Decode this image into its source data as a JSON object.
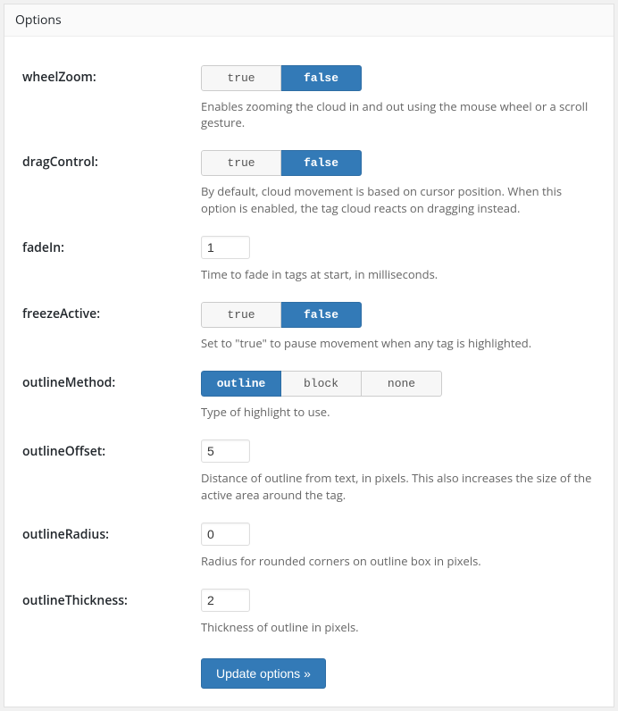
{
  "panel": {
    "title": "Options"
  },
  "options": {
    "wheelZoom": {
      "label": "wheelZoom:",
      "choices": [
        "true",
        "false"
      ],
      "selected": "false",
      "description": "Enables zooming the cloud in and out using the mouse wheel or a scroll gesture."
    },
    "dragControl": {
      "label": "dragControl:",
      "choices": [
        "true",
        "false"
      ],
      "selected": "false",
      "description": "By default, cloud movement is based on cursor position. When this option is enabled, the tag cloud reacts on dragging instead."
    },
    "fadeIn": {
      "label": "fadeIn:",
      "value": "1",
      "description": "Time to fade in tags at start, in milliseconds."
    },
    "freezeActive": {
      "label": "freezeActive:",
      "choices": [
        "true",
        "false"
      ],
      "selected": "false",
      "description": "Set to \"true\" to pause movement when any tag is highlighted."
    },
    "outlineMethod": {
      "label": "outlineMethod:",
      "choices": [
        "outline",
        "block",
        "none"
      ],
      "selected": "outline",
      "description": "Type of highlight to use."
    },
    "outlineOffset": {
      "label": "outlineOffset:",
      "value": "5",
      "description": "Distance of outline from text, in pixels. This also increases the size of the active area around the tag."
    },
    "outlineRadius": {
      "label": "outlineRadius:",
      "value": "0",
      "description": "Radius for rounded corners on outline box in pixels."
    },
    "outlineThickness": {
      "label": "outlineThickness:",
      "value": "2",
      "description": "Thickness of outline in pixels."
    }
  },
  "submit": {
    "label": "Update options »"
  }
}
